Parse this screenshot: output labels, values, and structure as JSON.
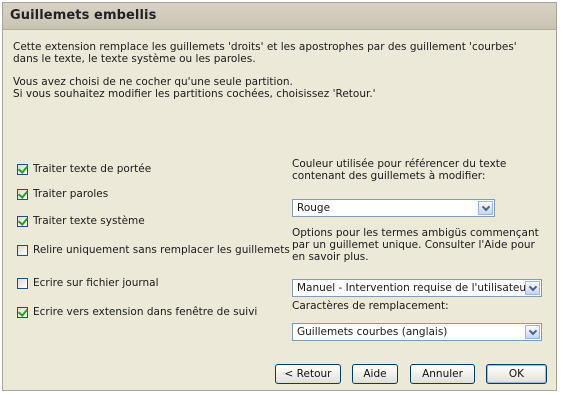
{
  "window": {
    "title": "Guillemets embellis"
  },
  "intro": {
    "p1": "Cette extension remplace les guillemets 'droits' et les apostrophes par des guillement 'courbes' dans le texte, le texte système ou les paroles.",
    "p2_l1": "Vous avez choisi de ne cocher qu'une seule partition.",
    "p2_l2": "Si vous souhaitez modifier les partitions cochées, choisissez 'Retour.'"
  },
  "options": [
    {
      "label": "Traiter texte de portée",
      "checked": true
    },
    {
      "label": "Traiter paroles",
      "checked": true
    },
    {
      "label": "Traiter texte système",
      "checked": true
    },
    {
      "label": "Relire uniquement sans remplacer les guillemets",
      "checked": false
    },
    {
      "label": "Ecrire sur fichier journal",
      "checked": false
    },
    {
      "label": "Ecrire vers extension dans fenêtre de suivi",
      "checked": true
    }
  ],
  "color": {
    "label": "Couleur utilisée pour référencer du texte contenant des guillemets à modifier:",
    "value": "Rouge"
  },
  "ambiguous": {
    "label": "Options pour les termes ambigüs commençant par un guillemet unique. Consulter l'Aide pour en savoir plus.",
    "value": "Manuel - Intervention requise de l'utilisateur"
  },
  "replacement": {
    "label": "Caractères de remplacement:",
    "value": "Guillemets courbes (anglais)"
  },
  "buttons": {
    "back": "< Retour",
    "help": "Aide",
    "cancel": "Annuler",
    "ok": "OK"
  }
}
